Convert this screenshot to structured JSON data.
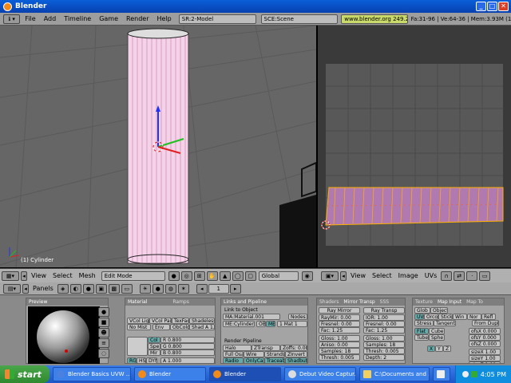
{
  "window": {
    "title": "Blender",
    "btn_min": "_",
    "btn_max": "□",
    "btn_close": "✕"
  },
  "menubar": {
    "items": [
      "File",
      "Add",
      "Timeline",
      "Game",
      "Render",
      "Help"
    ],
    "screen_selector": "SR:2-Model",
    "scene_selector": "SCE:Scene",
    "url": "www.blender.org 249.2",
    "stats": "Fa:31-96 | Ve:64-36 | Mem:3.93M (16.28M)"
  },
  "viewport3d": {
    "object_label": "(1) Cylinder"
  },
  "header3d": {
    "menus": [
      "View",
      "Select",
      "Mesh"
    ],
    "mode": "Edit Mode",
    "orientation": "Global"
  },
  "headeruv": {
    "menus": [
      "View",
      "Select",
      "Image",
      "UVs"
    ]
  },
  "buttons_window": {
    "panels_label": "Panels",
    "frame": "1",
    "preview": {
      "title": "Preview"
    },
    "material": {
      "tabs": [
        "Material",
        "Ramps"
      ],
      "flags": [
        "VCol Light",
        "VCol Paint",
        "TexFace",
        "Shadeless",
        "No Mist",
        "Env",
        "ObColor",
        "Shad A 1.00"
      ],
      "color_rows": [
        {
          "label": "Col",
          "value": "R 0.800"
        },
        {
          "label": "Spe",
          "value": "G 0.800"
        },
        {
          "label": "Mir",
          "value": "B 0.800"
        }
      ],
      "mode_buttons": [
        "RGB",
        "HSV",
        "DYN"
      ],
      "alpha": "A 1.000"
    },
    "links": {
      "tabs": [
        "Links and Pipeline"
      ],
      "link_to_object": "Link to Object",
      "material_name": "MA:Material.001",
      "nodes": "Nodes",
      "object": "ME:Cylinder",
      "ob": "OB",
      "ma": "ME",
      "mat_count": "1 Mat 1",
      "render_pipeline": "Render Pipeline",
      "pipeline_buttons": [
        "Halo",
        "ZTransp",
        "Zoffs: 0.00",
        "Full Osa",
        "Wire",
        "Strands",
        "ZInvert",
        "Radio",
        "OnlyCast",
        "Traceable",
        "Shadbuf"
      ]
    },
    "mirror": {
      "tabs": [
        "Shaders",
        "Mirror Transp",
        "SSS"
      ],
      "left_title": "Ray Mirror",
      "right_title": "Ray Transp",
      "left_values": [
        "RayMir: 0.00",
        "Fresnel: 0.00",
        "Fac: 1.25",
        "Gloss: 1.00",
        "Aniso: 0.00",
        "Samples: 18",
        "Thresh: 0.005",
        "Depth: 2",
        "Max Dist: 0.00"
      ],
      "right_values": [
        "IOR: 1.00",
        "Fresnel: 0.00",
        "Fac: 1.25",
        "Gloss: 1.00",
        "Samples: 18",
        "Thresh: 0.005",
        "Depth: 2",
        "Filter: 0.000",
        "Limit: 0.00"
      ]
    },
    "texture": {
      "tabs": [
        "Texture",
        "Map Input",
        "Map To"
      ],
      "rows": [
        "Glob",
        "Object",
        "UV",
        "Orco",
        "Stick",
        "Win",
        "Nor",
        "Refl",
        "Stress",
        "Tangent",
        "From Dupli",
        "Flat",
        "Cube",
        "Tube",
        "Sphe"
      ],
      "ofs": [
        "ofsX 0.000",
        "ofsY 0.000",
        "ofsZ 0.000"
      ],
      "size": [
        "sizeX 1.00",
        "sizeY 1.00",
        "sizeZ 1.00"
      ],
      "axes": [
        "X",
        "Y",
        "Z"
      ]
    }
  },
  "taskbar": {
    "start": "start",
    "tasks": [
      "Blender Basics UVW ...",
      "Blender",
      "Blender",
      "Debut Video Captur...",
      "C:\\Documents and ...",
      ""
    ],
    "clock": "4:05 PM"
  },
  "colors": {
    "title_blue": "#0a5fd8",
    "taskbar_blue": "#2563d6",
    "start_green": "#3a9a3a",
    "uv_orange": "#f0a020"
  }
}
